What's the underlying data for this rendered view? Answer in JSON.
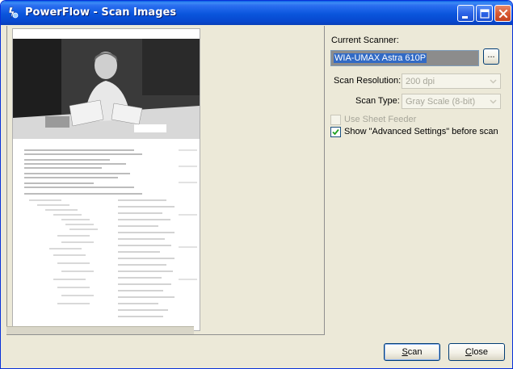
{
  "window": {
    "title": "PowerFlow - Scan Images"
  },
  "settings": {
    "current_scanner_label": "Current Scanner:",
    "current_scanner_value": "WIA-UMAX Astra 610P",
    "browse_label": "...",
    "resolution_label": "Scan Resolution:",
    "resolution_value": "200 dpi",
    "scan_type_label": "Scan Type:",
    "scan_type_value": "Gray Scale (8-bit)",
    "sheet_feeder_label": "Use Sheet Feeder",
    "sheet_feeder_checked": false,
    "advanced_label": "Show \"Advanced Settings\" before scan",
    "advanced_checked": true
  },
  "buttons": {
    "scan_mnemonic": "S",
    "scan_rest": "can",
    "close_mnemonic": "C",
    "close_rest": "lose"
  },
  "colors": {
    "title_bar": "#0a55dc",
    "window_bg": "#ece9d8",
    "selection": "#316ac5",
    "close_button": "#d95a33"
  }
}
